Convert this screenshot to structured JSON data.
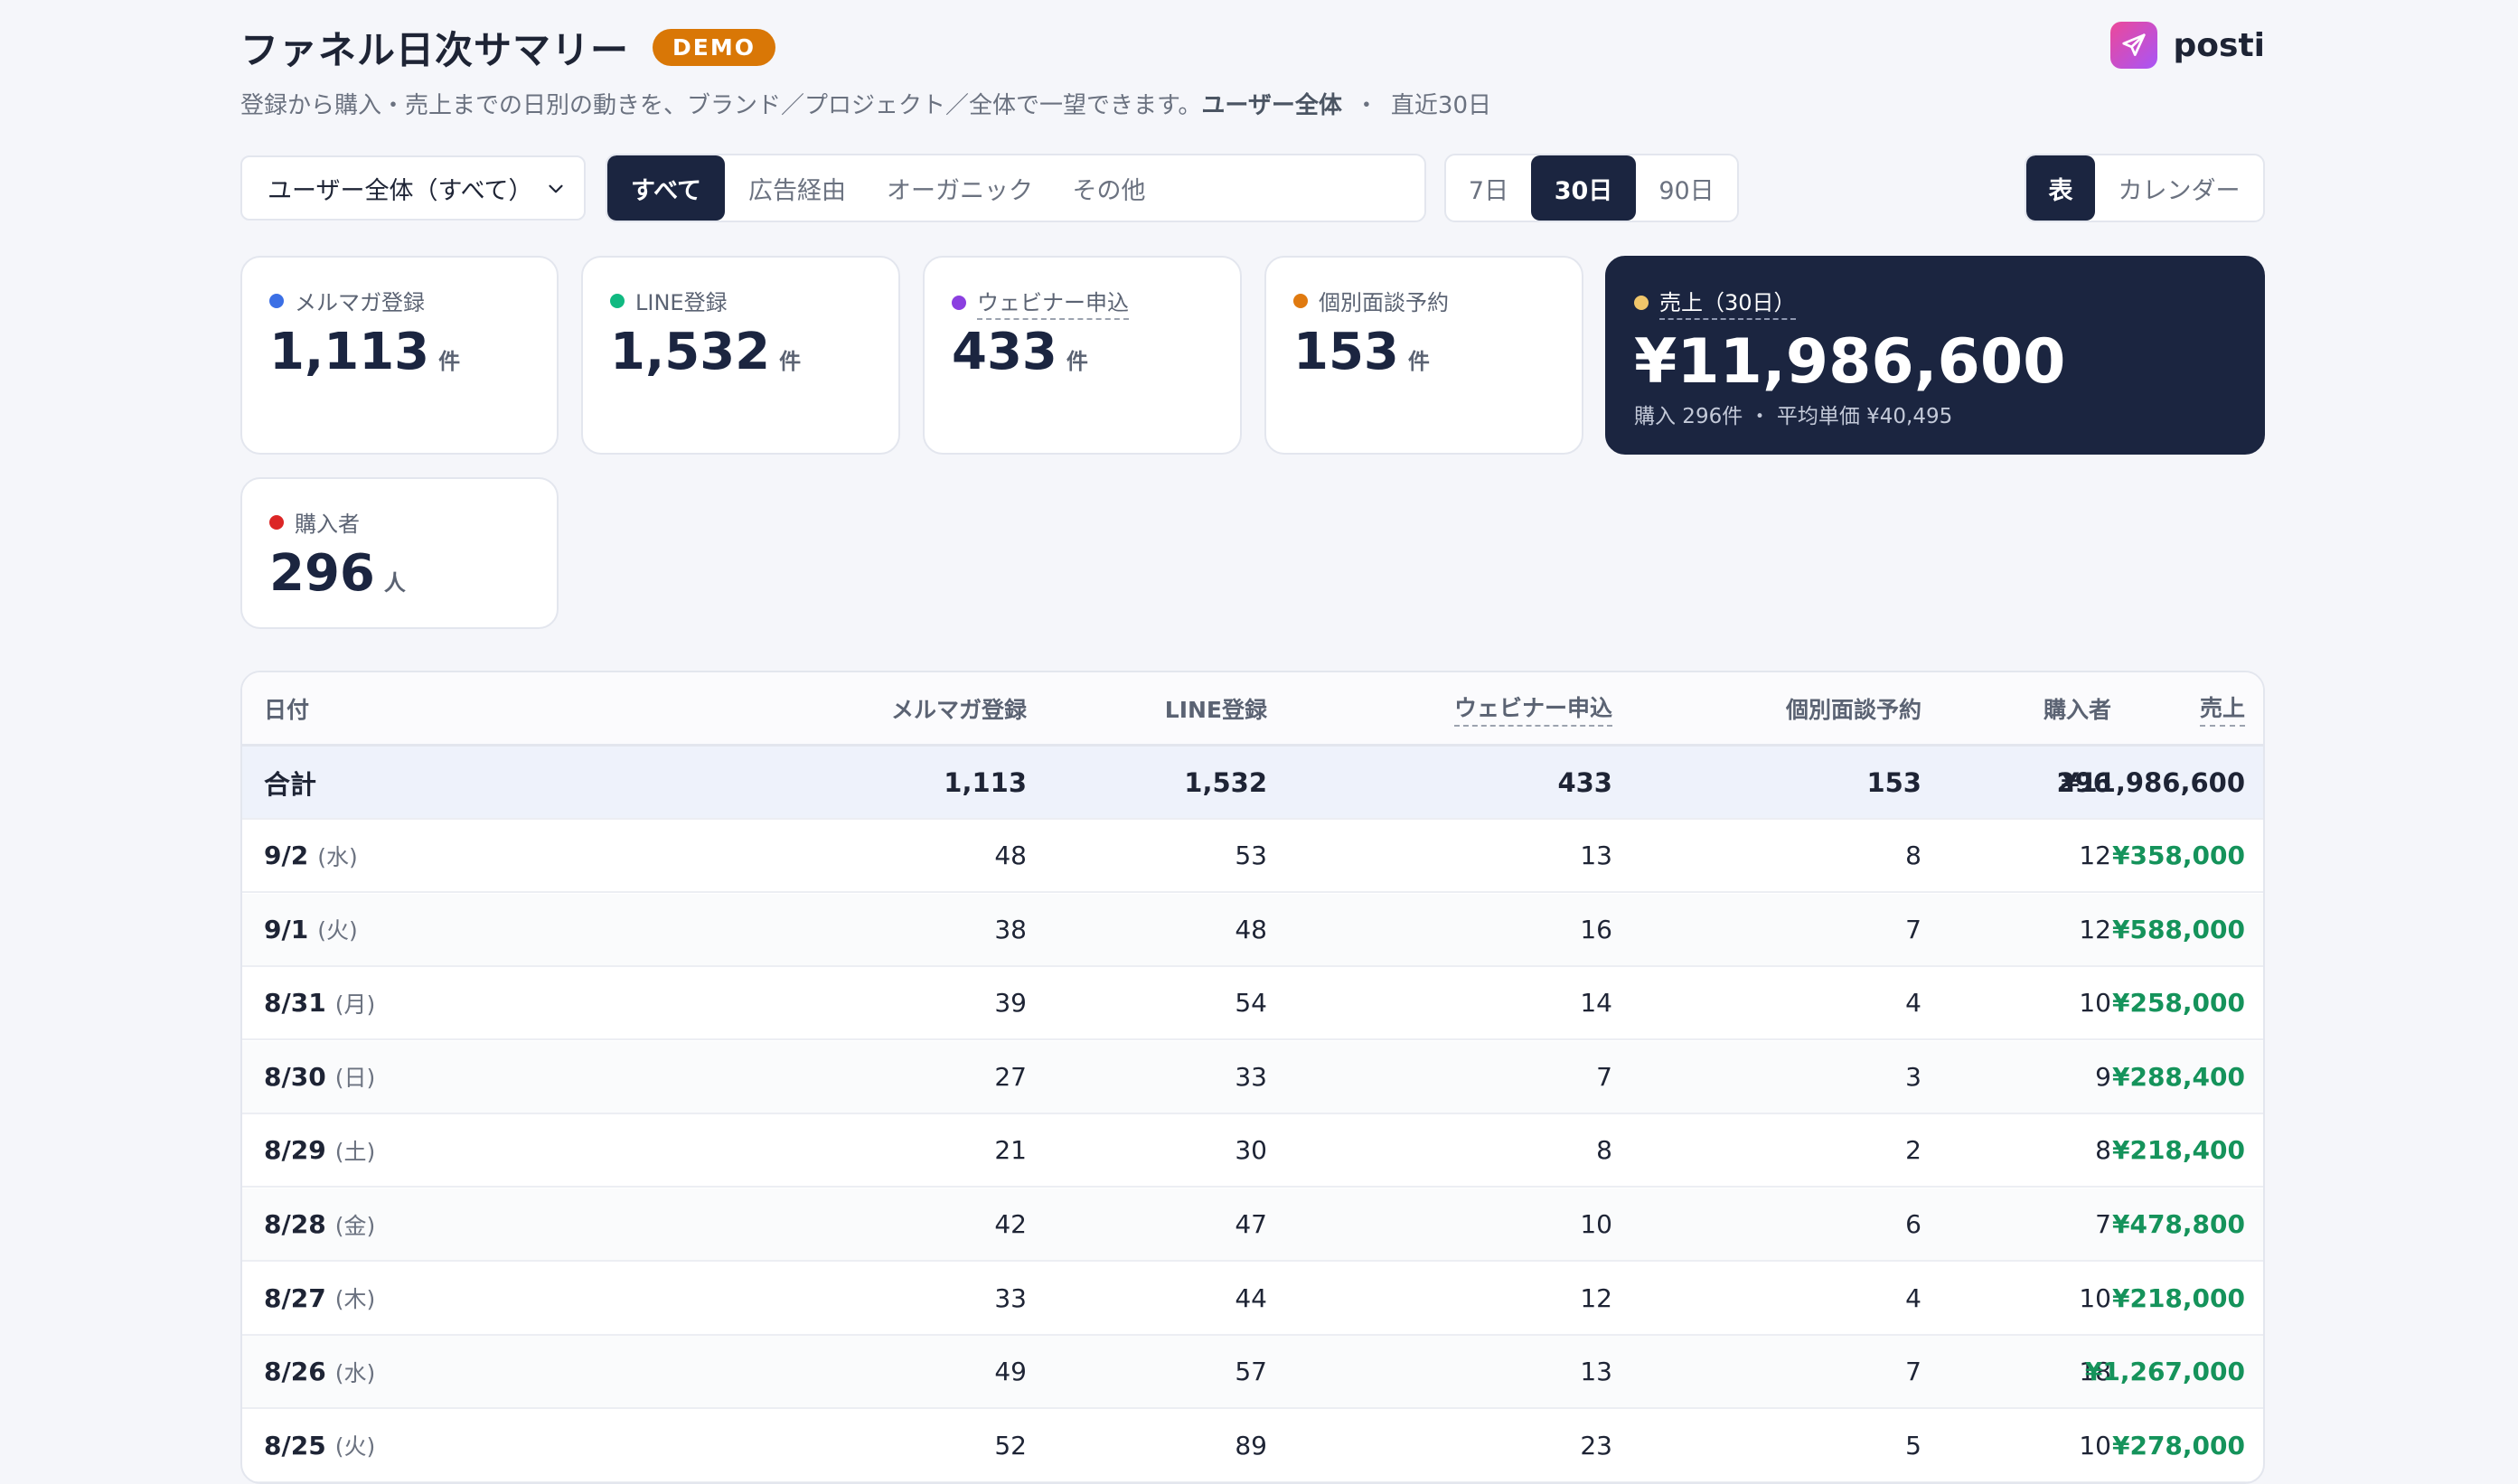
{
  "header": {
    "title": "ファネル日次サマリー",
    "badge": "DEMO",
    "subtitle_pre": "登録から購入・売上までの日別の動きを、ブランド／プロジェクト／全体で一望できます。",
    "subtitle_scope": "ユーザー全体",
    "subtitle_sep": "・",
    "subtitle_period": "直近30日",
    "brand": "posti"
  },
  "controls": {
    "user_select": "ユーザー全体（すべて）",
    "source_filter": [
      "すべて",
      "広告経由",
      "オーガニック",
      "その他"
    ],
    "source_active": 0,
    "range_filter": [
      "7日",
      "30日",
      "90日"
    ],
    "range_active": 1,
    "view_toggle": [
      "表",
      "カレンダー"
    ],
    "view_active": 0
  },
  "cards": {
    "newsletter": {
      "label": "メルマガ登録",
      "value": "1,113",
      "unit": "件",
      "color": "#3b6fe5"
    },
    "line": {
      "label": "LINE登録",
      "value": "1,532",
      "unit": "件",
      "color": "#10b981"
    },
    "webinar": {
      "label": "ウェビナー申込",
      "value": "433",
      "unit": "件",
      "color": "#8b3fe0"
    },
    "consult": {
      "label": "個別面談予約",
      "value": "153",
      "unit": "件",
      "color": "#e07a10"
    },
    "sales": {
      "label": "売上（30日）",
      "value": "¥11,986,600",
      "sub": "購入 296件 ・ 平均単価 ¥40,495",
      "color": "#f0c66b"
    },
    "buyers": {
      "label": "購入者",
      "value": "296",
      "unit": "人",
      "color": "#dc2626"
    }
  },
  "table": {
    "columns": [
      "日付",
      "メルマガ登録",
      "LINE登録",
      "ウェビナー申込",
      "個別面談予約",
      "購入者",
      "売上"
    ],
    "total": {
      "label": "合計",
      "newsletter": "1,113",
      "line": "1,532",
      "webinar": "433",
      "consult": "153",
      "buyers": "296",
      "sales": "¥11,986,600"
    },
    "rows": [
      {
        "date": "9/2",
        "dow": "(水)",
        "newsletter": "48",
        "line": "53",
        "webinar": "13",
        "consult": "8",
        "buyers": "12",
        "sales": "¥358,000"
      },
      {
        "date": "9/1",
        "dow": "(火)",
        "newsletter": "38",
        "line": "48",
        "webinar": "16",
        "consult": "7",
        "buyers": "12",
        "sales": "¥588,000"
      },
      {
        "date": "8/31",
        "dow": "(月)",
        "newsletter": "39",
        "line": "54",
        "webinar": "14",
        "consult": "4",
        "buyers": "10",
        "sales": "¥258,000"
      },
      {
        "date": "8/30",
        "dow": "(日)",
        "newsletter": "27",
        "line": "33",
        "webinar": "7",
        "consult": "3",
        "buyers": "9",
        "sales": "¥288,400"
      },
      {
        "date": "8/29",
        "dow": "(土)",
        "newsletter": "21",
        "line": "30",
        "webinar": "8",
        "consult": "2",
        "buyers": "8",
        "sales": "¥218,400"
      },
      {
        "date": "8/28",
        "dow": "(金)",
        "newsletter": "42",
        "line": "47",
        "webinar": "10",
        "consult": "6",
        "buyers": "7",
        "sales": "¥478,800"
      },
      {
        "date": "8/27",
        "dow": "(木)",
        "newsletter": "33",
        "line": "44",
        "webinar": "12",
        "consult": "4",
        "buyers": "10",
        "sales": "¥218,000"
      },
      {
        "date": "8/26",
        "dow": "(水)",
        "newsletter": "49",
        "line": "57",
        "webinar": "13",
        "consult": "7",
        "buyers": "18",
        "sales": "¥1,267,000"
      },
      {
        "date": "8/25",
        "dow": "(火)",
        "newsletter": "52",
        "line": "89",
        "webinar": "23",
        "consult": "5",
        "buyers": "10",
        "sales": "¥278,000"
      }
    ]
  }
}
